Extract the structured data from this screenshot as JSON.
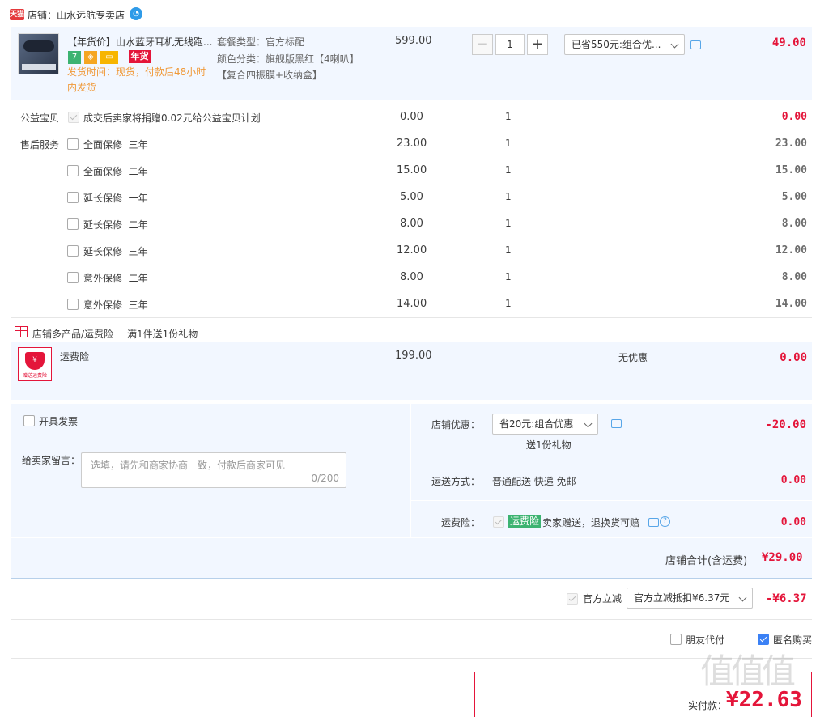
{
  "shop": {
    "badge": "天猫",
    "name": "店铺：山水远航专卖店"
  },
  "product": {
    "title": "【年货价】山水蓝牙耳机无线跑...",
    "tag_year": "年货",
    "tag_7": "7",
    "ship_note": "发货时间：现货，付款后48小时内发货",
    "package_type_label": "套餐类型：",
    "package_type": "官方标配",
    "color_label": "颜色分类：",
    "color": "旗舰版黑红【4喇叭】",
    "color_extra": "【复合四振膜+收纳盒】",
    "price": "599.00",
    "qty": "1",
    "discount_select": "已省550元:组合优...",
    "total": "49.00"
  },
  "services": {
    "charity_label": "公益宝贝",
    "charity_text": "成交后卖家将捐赠0.02元给公益宝贝计划",
    "charity_price": "0.00",
    "charity_qty": "1",
    "charity_total": "0.00",
    "aftersale_label": "售后服务",
    "items": [
      {
        "name": "全面保修  三年",
        "price": "23.00",
        "qty": "1",
        "total": "23.00"
      },
      {
        "name": "全面保修  二年",
        "price": "15.00",
        "qty": "1",
        "total": "15.00"
      },
      {
        "name": "延长保修  一年",
        "price": "5.00",
        "qty": "1",
        "total": "5.00"
      },
      {
        "name": "延长保修  二年",
        "price": "8.00",
        "qty": "1",
        "total": "8.00"
      },
      {
        "name": "延长保修  三年",
        "price": "12.00",
        "qty": "1",
        "total": "12.00"
      },
      {
        "name": "意外保修  二年",
        "price": "8.00",
        "qty": "1",
        "total": "8.00"
      },
      {
        "name": "意外保修  三年",
        "price": "14.00",
        "qty": "1",
        "total": "14.00"
      }
    ]
  },
  "promo": {
    "header": "店铺多产品/运费险",
    "gift": "满1件送1份礼物",
    "item_name": "运费险",
    "item_img_text": "赠送运费险",
    "item_price": "199.00",
    "item_discount": "无优惠",
    "item_total": "0.00"
  },
  "order": {
    "invoice_label": "开具发票",
    "message_label": "给卖家留言：",
    "message_placeholder": "选填，请先和商家协商一致，付款后商家可见",
    "message_count": "0/200",
    "shop_discount_label": "店铺优惠：",
    "shop_discount_select": "省20元:组合优惠",
    "shop_discount_gift": "送1份礼物",
    "shop_discount_total": "-20.00",
    "shipping_label": "运送方式：",
    "shipping_value": "普通配送 快递 免邮",
    "shipping_total": "0.00",
    "freight_label": "运费险：",
    "freight_badge": "运费险",
    "freight_text": "卖家赠送，退换货可赔",
    "freight_total": "0.00",
    "shop_sum_label": "店铺合计(含运费)",
    "shop_sum": "¥29.00"
  },
  "official": {
    "label": "官方立减",
    "select": "官方立减抵扣¥6.37元",
    "total": "-¥6.37"
  },
  "options": {
    "friend_pay": "朋友代付",
    "anonymous": "匿名购买"
  },
  "payment": {
    "label": "实付款：",
    "amount": "¥22.63"
  },
  "watermark": "值值值"
}
